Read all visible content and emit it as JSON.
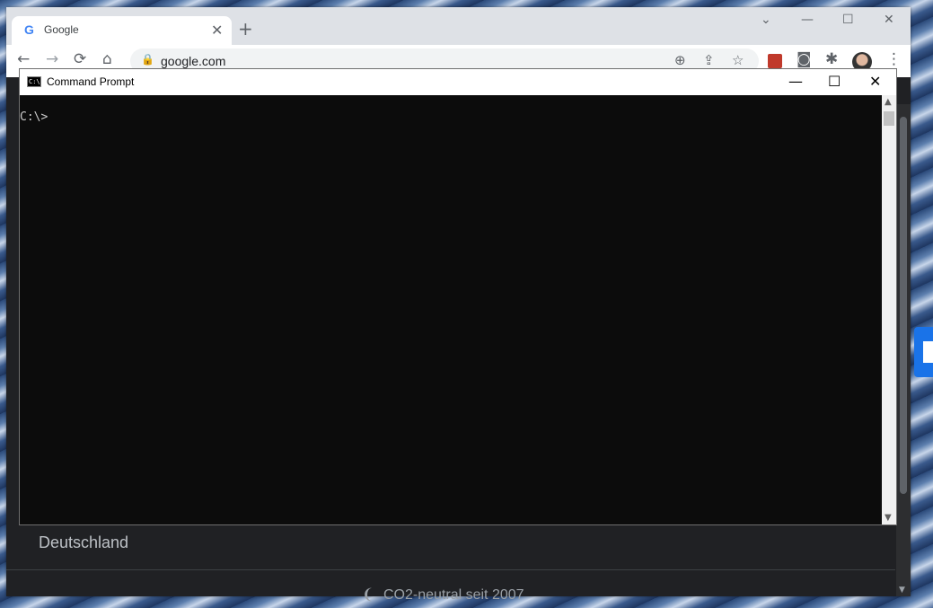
{
  "browser": {
    "tab": {
      "favicon": "G",
      "title": "Google",
      "close": "✕"
    },
    "new_tab": "+",
    "window_controls": {
      "tab_search": "⌄",
      "minimize": "—",
      "maximize": "☐",
      "close": "✕"
    },
    "toolbar": {
      "back": "←",
      "forward": "→",
      "reload": "⟳",
      "home": "⌂",
      "url": "google.com",
      "zoom": "⊕",
      "share": "⇪",
      "bookmark": "☆",
      "camera": "◙",
      "extensions": "✱",
      "menu": "⋮"
    }
  },
  "google_page": {
    "country": "Deutschland",
    "co2": "CO2-neutral seit 2007",
    "leaf": "❨"
  },
  "cmd": {
    "title": "Command Prompt",
    "icon_text": "C:\\",
    "controls": {
      "minimize": "—",
      "maximize": "☐",
      "close": "✕"
    },
    "prompt": "C:\\>",
    "scroll_up": "▲",
    "scroll_down": "▼"
  }
}
